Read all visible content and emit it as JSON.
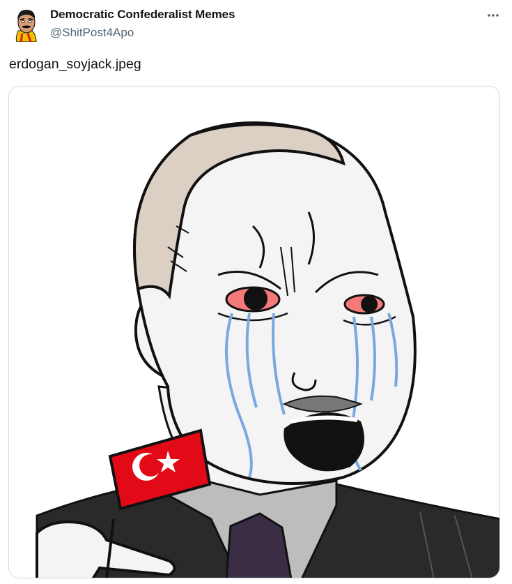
{
  "tweet": {
    "author": {
      "display_name": "Democratic Confederalist Memes",
      "handle": "@ShitPost4Apo",
      "avatar_icon": "avatar-cartoon-man-icon"
    },
    "more_icon": "more-horizontal-icon",
    "text": "erdogan_soyjack.jpeg",
    "media": {
      "kind": "image",
      "icon": "soyjak-meme-image",
      "flag": {
        "background": "#e30a17",
        "emblem_color": "#ffffff"
      }
    }
  },
  "colors": {
    "text_primary": "#0f1419",
    "text_secondary": "#536471",
    "border": "#cfd9de",
    "tears": "#79a8e0",
    "eye_red": "#f47a7a",
    "hair": "#dccfc4",
    "suit": "#2a2a2a",
    "shirt": "#bdbdbd",
    "tie": "#3b2e44"
  }
}
